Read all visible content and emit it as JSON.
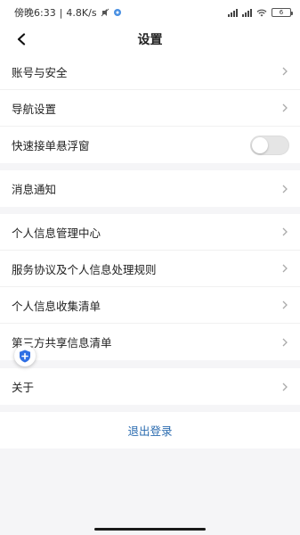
{
  "status_bar": {
    "time": "傍晚6:33",
    "network_speed": "4.8K/s",
    "separator": "|",
    "battery": "6"
  },
  "header": {
    "title": "设置",
    "back_icon": "chevron-left-icon"
  },
  "groups": [
    {
      "items": [
        {
          "label": "账号与安全",
          "type": "link"
        },
        {
          "label": "导航设置",
          "type": "link"
        },
        {
          "label": "快速接单悬浮窗",
          "type": "toggle",
          "on": false
        }
      ]
    },
    {
      "items": [
        {
          "label": "消息通知",
          "type": "link"
        }
      ]
    },
    {
      "items": [
        {
          "label": "个人信息管理中心",
          "type": "link"
        },
        {
          "label": "服务协议及个人信息处理规则",
          "type": "link"
        },
        {
          "label": "个人信息收集清单",
          "type": "link"
        },
        {
          "label": "第三方共享信息清单",
          "type": "link"
        }
      ]
    },
    {
      "items": [
        {
          "label": "关于",
          "type": "link"
        }
      ]
    }
  ],
  "logout_label": "退出登录",
  "colors": {
    "accent": "#2b6cb0",
    "background": "#f5f5f7",
    "float_icon": "#2f6fe4"
  }
}
